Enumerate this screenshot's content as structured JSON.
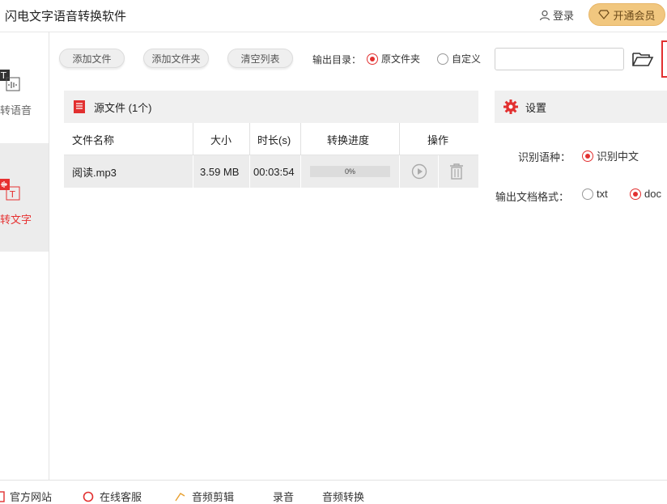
{
  "app": {
    "title": "闪电文字语音转换软件"
  },
  "header": {
    "login_label": "登录",
    "vip_label": "开通会员"
  },
  "sidebar": {
    "items": [
      {
        "label": "本转语音",
        "active": false
      },
      {
        "label": "音转文字",
        "active": true
      }
    ]
  },
  "toolbar": {
    "add_file": "添加文件",
    "add_folder": "添加文件夹",
    "clear_list": "清空列表",
    "output_dir_label": "输出目录：",
    "output_options": [
      {
        "label": "原文件夹",
        "selected": true
      },
      {
        "label": "自定义",
        "selected": false
      }
    ],
    "path_value": ""
  },
  "file_panel": {
    "title": "源文件 (1个)",
    "columns": [
      "文件名称",
      "大小",
      "时长(s)",
      "转换进度",
      "操作"
    ],
    "rows": [
      {
        "name": "阅读.mp3",
        "size": "3.59 MB",
        "duration": "00:03:54",
        "progress": "0%"
      }
    ]
  },
  "settings": {
    "title": "设置",
    "language_label": "识别语种：",
    "language_options": [
      {
        "label": "识别中文",
        "selected": true
      }
    ],
    "format_label": "输出文档格式：",
    "format_options": [
      {
        "label": "txt",
        "selected": false
      },
      {
        "label": "doc",
        "selected": true
      }
    ]
  },
  "footer": {
    "items": [
      "官方网站",
      "在线客服",
      "音频剪辑",
      "录音",
      "音频转换"
    ]
  },
  "colors": {
    "accent": "#e23030",
    "vip_bg": "#f1c77f"
  }
}
